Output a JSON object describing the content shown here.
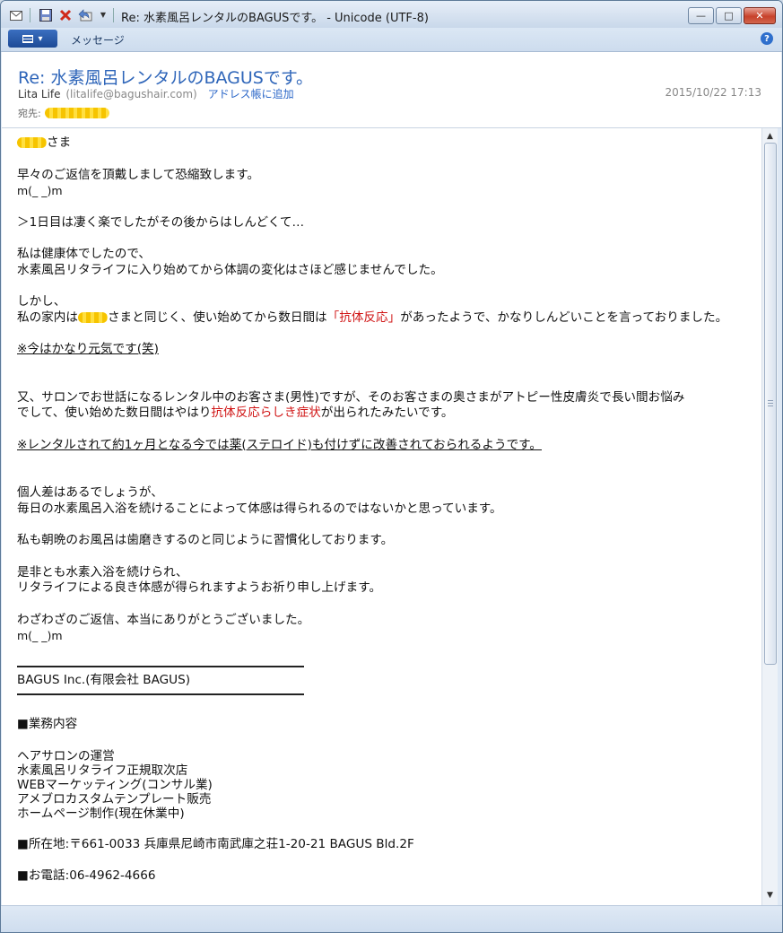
{
  "window": {
    "title": "Re: 水素風呂レンタルのBAGUSです。 - Unicode (UTF-8)",
    "minimize_glyph": "—",
    "maximize_glyph": "□",
    "close_glyph": "✕"
  },
  "quick_access": {
    "icons": [
      "mail-icon",
      "save-icon",
      "delete-icon",
      "reply-icon",
      "dropdown-icon"
    ]
  },
  "ribbon": {
    "tab_label": "メッセージ",
    "help_glyph": "?"
  },
  "header": {
    "subject": "Re: 水素風呂レンタルのBAGUSです。",
    "from_name": "Lita Life",
    "from_email": "(litalife@bagushair.com)",
    "add_to_address_book": "アドレス帳に追加",
    "date": "2015/10/22 17:13",
    "to_label": "宛先:"
  },
  "body": {
    "greeting_suffix": "さま",
    "line_1": "早々のご返信を頂戴しまして恐縮致します。",
    "bow_1": "m(_ _)m",
    "quote": "＞1日目は凄く楽でしたがその後からはしんどくて…",
    "para2_l1": "私は健康体でしたので、",
    "para2_l2": "水素風呂リタライフに入り始めてから体調の変化はさほど感じませんでした。",
    "para3_l1": "しかし、",
    "para3_l2_a": "私の家内は",
    "para3_l2_b": "さまと同じく、使い始めてから数日間は",
    "para3_l2_red": "「抗体反応」",
    "para3_l2_c": "があったようで、かなりしんどいことを言っておりました。",
    "note_1": "※今はかなり元気です(笑)",
    "para4_l1": "又、サロンでお世話になるレンタル中のお客さま(男性)ですが、そのお客さまの奥さまがアトピー性皮膚炎で長い間お悩み",
    "para4_l2_a": "でして、使い始めた数日間はやはり",
    "para4_l2_red": "抗体反応らしき症状",
    "para4_l2_b": "が出られたみたいです。",
    "note_2": "※レンタルされて約1ヶ月となる今では薬(ステロイド)も付けずに改善されておられるようです。",
    "para5_l1": "個人差はあるでしょうが、",
    "para5_l2": "毎日の水素風呂入浴を続けることによって体感は得られるのではないかと思っています。",
    "para6": "私も朝晩のお風呂は歯磨きするのと同じように習慣化しております。",
    "para7_l1": "是非とも水素入浴を続けられ、",
    "para7_l2": "リタライフによる良き体感が得られますようお祈り申し上げます。",
    "para8": "わざわざのご返信、本当にありがとうございました。",
    "bow_2": "m(_ _)m",
    "sig_company": "BAGUS Inc.(有限会社 BAGUS)",
    "sig_business_heading": "■業務内容",
    "sig_business_items": [
      "ヘアサロンの運営",
      "水素風呂リタライフ正規取次店",
      "WEBマーケッティング(コンサル業)",
      "アメブロカスタムテンプレート販売",
      "ホームページ制作(現在休業中)"
    ],
    "sig_address": "■所在地:〒661-0033 兵庫県尼崎市南武庫之荘1-20-21 BAGUS Bld.2F",
    "sig_phone": "■お電話:06-4962-4666"
  },
  "scrollbar": {
    "up_glyph": "▲",
    "down_glyph": "▼"
  }
}
